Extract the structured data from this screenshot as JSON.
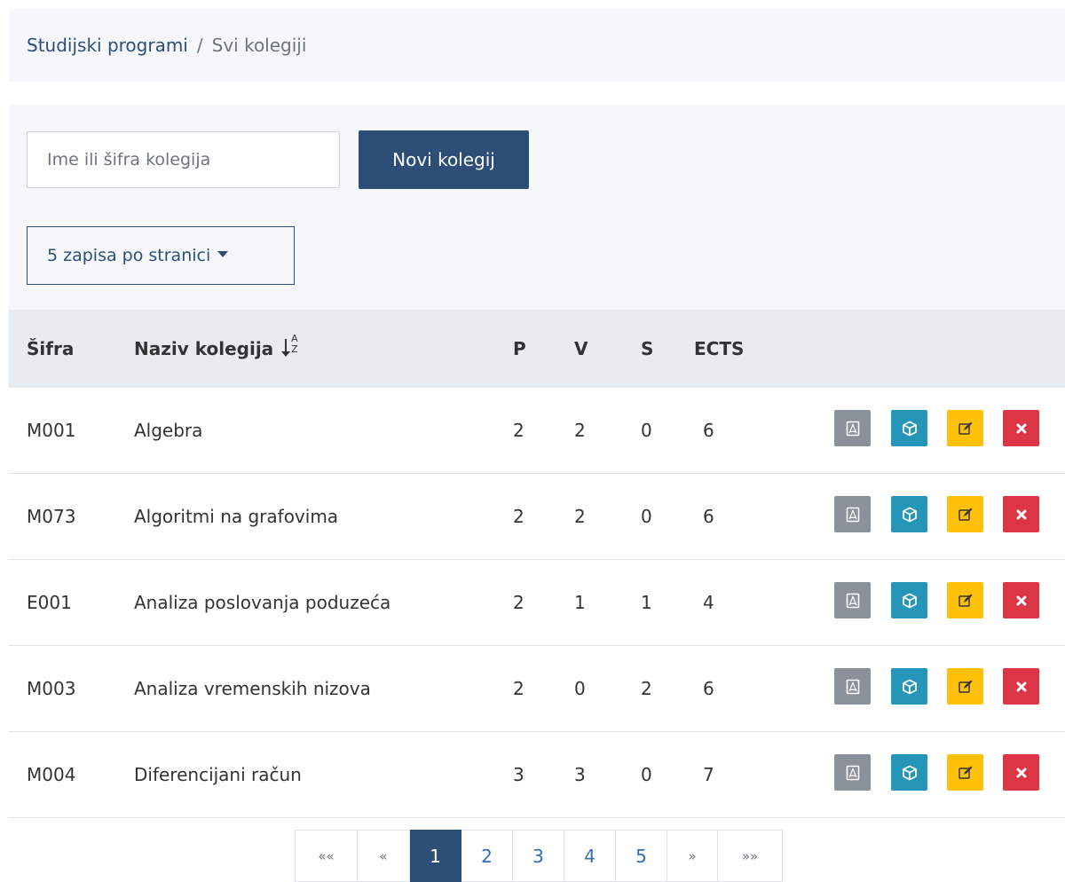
{
  "breadcrumb": {
    "root": "Studijski programi",
    "separator": "/",
    "current": "Svi kolegiji"
  },
  "toolbar": {
    "search_placeholder": "Ime ili šifra kolegija",
    "new_button": "Novi kolegij",
    "per_page_label": "5 zapisa po stranici"
  },
  "table": {
    "columns": {
      "code": "Šifra",
      "name": "Naziv kolegija",
      "sort_letters_top": "A",
      "sort_letters_bottom": "Z",
      "p": "P",
      "v": "V",
      "s": "S",
      "ects": "ECTS"
    },
    "rows": [
      {
        "code": "M001",
        "name": "Algebra",
        "p": "2",
        "v": "2",
        "s": "0",
        "ects": "6"
      },
      {
        "code": "M073",
        "name": "Algoritmi na grafovima",
        "p": "2",
        "v": "2",
        "s": "0",
        "ects": "6"
      },
      {
        "code": "E001",
        "name": "Analiza poslovanja poduzeća",
        "p": "2",
        "v": "1",
        "s": "1",
        "ects": "4"
      },
      {
        "code": "M003",
        "name": "Analiza vremenskih nizova",
        "p": "2",
        "v": "0",
        "s": "2",
        "ects": "6"
      },
      {
        "code": "M004",
        "name": "Diferencijani račun",
        "p": "3",
        "v": "3",
        "s": "0",
        "ects": "7"
      }
    ],
    "action_icons": [
      "pdf-icon",
      "cube-icon",
      "edit-icon",
      "delete-icon"
    ]
  },
  "pagination": {
    "first": "««",
    "prev": "«",
    "pages": [
      "1",
      "2",
      "3",
      "4",
      "5"
    ],
    "active_page": "1",
    "next": "»",
    "last": "»»"
  },
  "colors": {
    "primary": "#2d4e77",
    "pdf": "#8a9199",
    "info": "#2596b8",
    "warning": "#ffc107",
    "danger": "#dc3545"
  }
}
